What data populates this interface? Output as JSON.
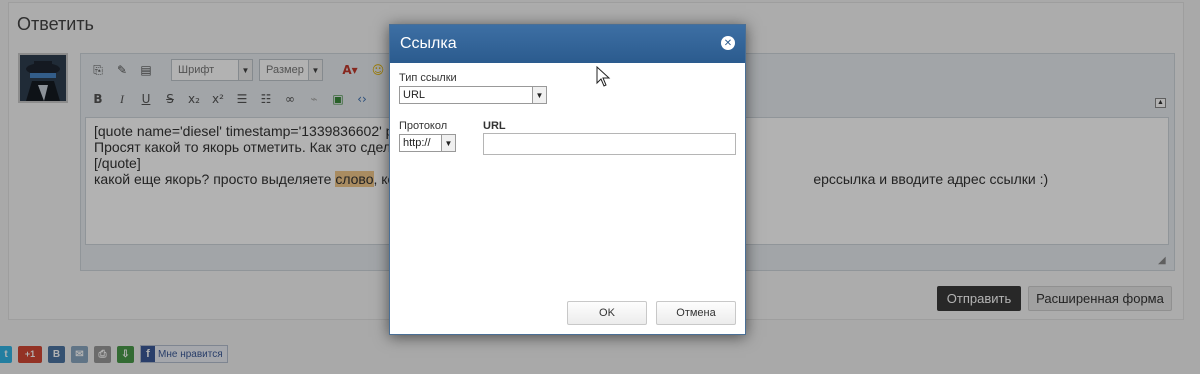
{
  "reply": {
    "title": "Ответить",
    "submit_label": "Отправить",
    "advanced_label": "Расширенная форма"
  },
  "toolbar": {
    "font_select": "Шрифт",
    "size_select": "Размер"
  },
  "editor": {
    "line1": "[quote name='diesel' timestamp='1339836602' p",
    "line2": "Просят какой то якорь отметить. Как это сдела",
    "line3": "[/quote]",
    "line4_before": "какой еще якорь? просто выделяете ",
    "line4_highlight": "слово",
    "line4_after": ", ко",
    "line4_tail": "ерссылка и вводите адрес ссылки :)"
  },
  "share": {
    "gplus_label": "+1",
    "vk_label": "B",
    "like_label": "Мне нравится"
  },
  "dialog": {
    "title": "Ссылка",
    "link_type_label": "Тип ссылки",
    "link_type_value": "URL",
    "protocol_label": "Протокол",
    "protocol_value": "http://",
    "url_label": "URL",
    "url_value": "",
    "ok_label": "OK",
    "cancel_label": "Отмена"
  },
  "colors": {
    "dialog_header": "#2b5b8e",
    "highlight": "#f3c98b",
    "submit_bg": "#3a3a3a"
  }
}
